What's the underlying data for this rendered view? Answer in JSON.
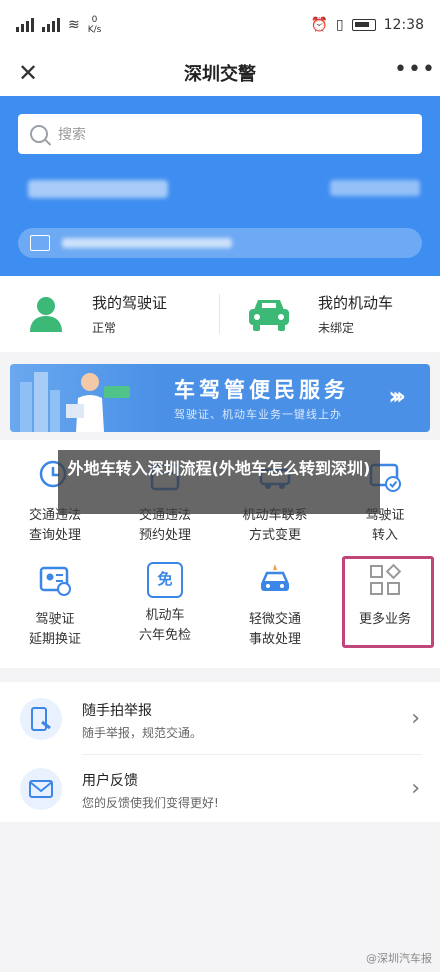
{
  "status": {
    "netspeed_top": "0",
    "netspeed_unit": "K/s",
    "time": "12:38"
  },
  "nav": {
    "close_icon": "close-icon",
    "title": "深圳交警",
    "more": "•••"
  },
  "search": {
    "placeholder": "搜索"
  },
  "licenses": [
    {
      "title": "我的驾驶证",
      "status": "正常",
      "icon": "person-icon"
    },
    {
      "title": "我的机动车",
      "status": "未绑定",
      "icon": "car-icon"
    }
  ],
  "banner": {
    "title": "车驾管便民服务",
    "subtitle": "驾驶证、机动车业务一键线上办",
    "chevrons": "›››"
  },
  "overlay": {
    "title": "外地车转入深圳流程(外地车怎么转到深圳)"
  },
  "services": [
    {
      "line1": "交通违法",
      "line2": "查询处理"
    },
    {
      "line1": "交通违法",
      "line2": "预约处理"
    },
    {
      "line1": "机动车联系",
      "line2": "方式变更"
    },
    {
      "line1": "驾驶证",
      "line2": "转入"
    },
    {
      "line1": "驾驶证",
      "line2": "延期换证"
    },
    {
      "line1": "机动车",
      "line2": "六年免检"
    },
    {
      "line1": "轻微交通",
      "line2": "事故处理"
    },
    {
      "line1": "更多业务",
      "line2": ""
    }
  ],
  "exempt_icon_text": "免",
  "list": [
    {
      "title": "随手拍举报",
      "desc": "随手举报，规范交通。",
      "icon": "camera-report-icon"
    },
    {
      "title": "用户反馈",
      "desc": "您的反馈使我们变得更好!",
      "icon": "mail-icon"
    }
  ],
  "watermark": "@深圳汽车报",
  "colors": {
    "brand_blue": "#3e8df0",
    "icon_blue": "#3b86e6",
    "green": "#3cb877",
    "highlight": "#c2457a"
  }
}
